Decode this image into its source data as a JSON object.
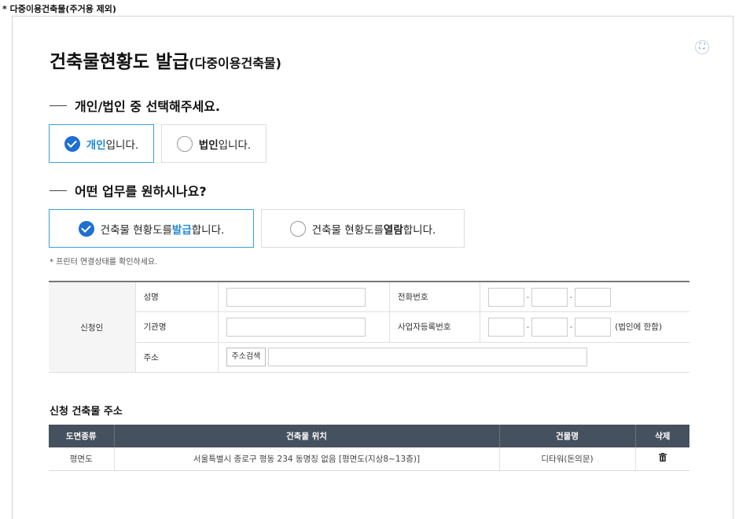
{
  "top_note": "* 다중이용건축물(주거용 제외)",
  "title_main": "건축물현황도 발급",
  "title_sub": "(다중이용건축물)",
  "section1": {
    "heading": "개인/법인 중 선택해주세요.",
    "opt_personal_strong": "개인",
    "opt_personal_rest": " 입니다.",
    "opt_corp_strong": "법인",
    "opt_corp_rest": " 입니다."
  },
  "section2": {
    "heading": "어떤 업무를 원하시나요?",
    "opt_issue_pre": "건축물 현황도를 ",
    "opt_issue_strong": "발급",
    "opt_issue_post": "합니다.",
    "opt_view_pre": "건축물 현황도를 ",
    "opt_view_strong": "열람",
    "opt_view_post": "합니다."
  },
  "printer_note": "* 프린터 연결상태를 확인하세요.",
  "form": {
    "applicant_label": "신청인",
    "name_label": "성명",
    "phone_label": "전화번호",
    "org_label": "기관명",
    "bizno_label": "사업자등록번호",
    "bizno_note": "(법인에 한함)",
    "address_label": "주소",
    "address_search": "주소검색",
    "sep": "-"
  },
  "building_section": {
    "title": "신청 건축물 주소",
    "columns": [
      "도면종류",
      "건축물 위치",
      "건물명",
      "삭제"
    ],
    "rows": [
      {
        "type": "평면도",
        "location": "서울특별시 종로구 평동 234 동명칭 없음 [평면도(지상8~13층)]",
        "name": "디타워(돈의문)"
      }
    ]
  },
  "icons": {
    "fullscreen": "fullscreen-icon",
    "delete": "trash-icon",
    "check": "check-circle-icon",
    "radio": "radio-empty-icon"
  },
  "colors": {
    "accent": "#1e6fd0",
    "highlight": "#1e88d8",
    "header_bg": "#46515f",
    "selected_border": "#3aa0dc"
  }
}
